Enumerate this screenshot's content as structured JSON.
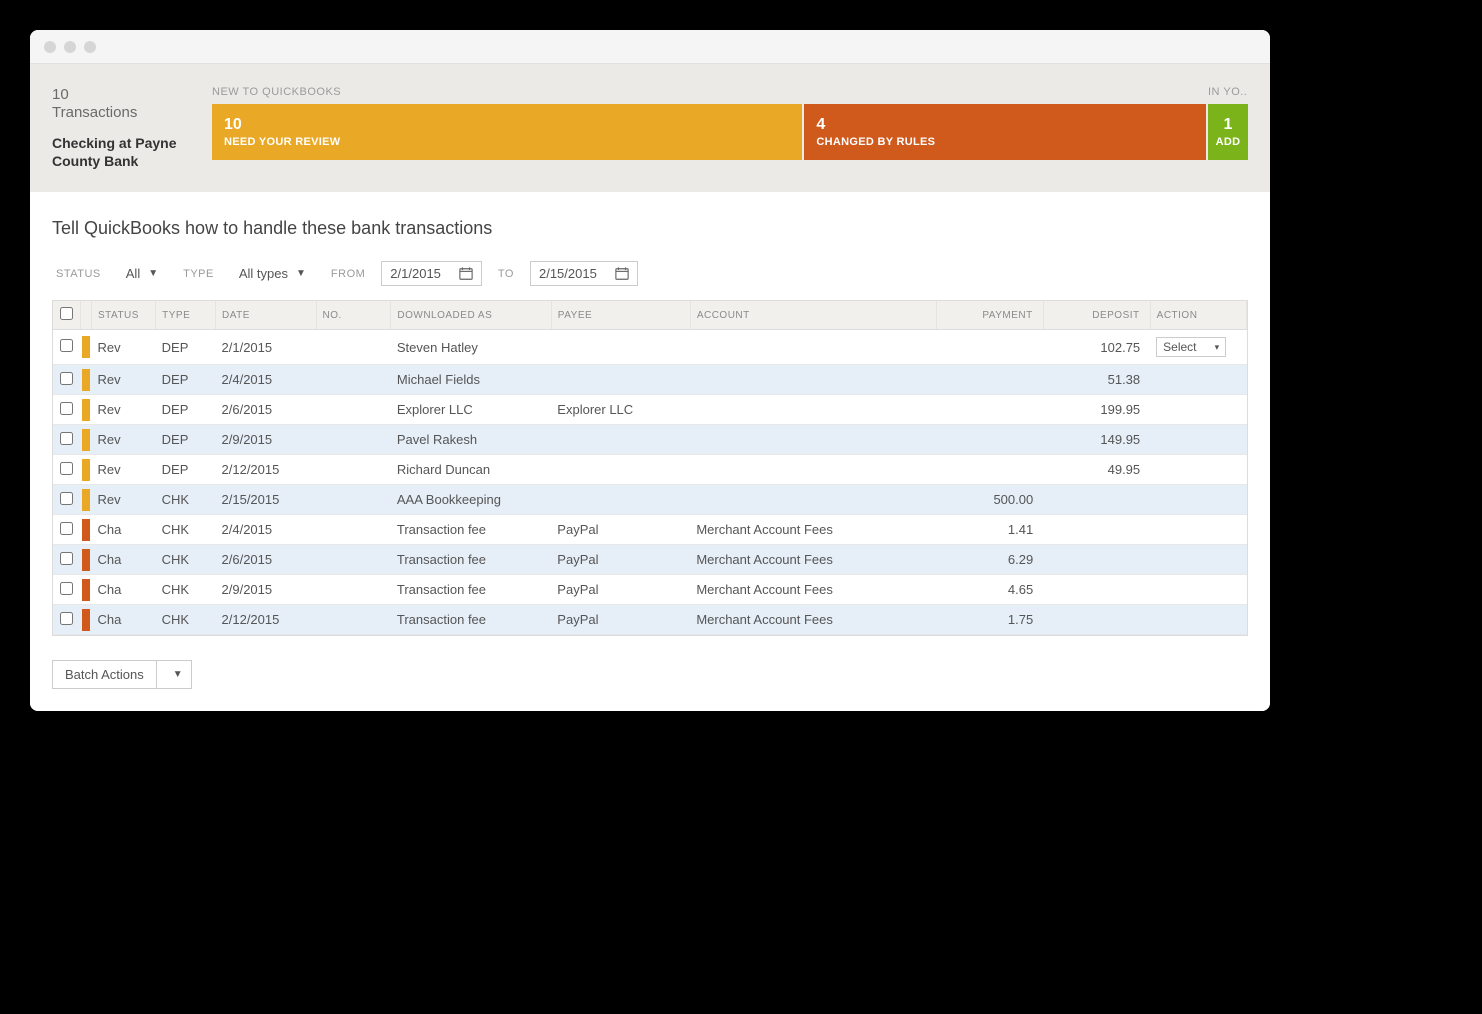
{
  "summary": {
    "count": "10",
    "count_label": "Transactions",
    "account": "Checking at Payne County Bank"
  },
  "tab_groups": {
    "left_label": "NEW TO QUICKBOOKS",
    "right_label": "IN YO..."
  },
  "tabs": {
    "review": {
      "count": "10",
      "label": "NEED YOUR REVIEW"
    },
    "changed": {
      "count": "4",
      "label": "CHANGED BY RULES"
    },
    "add": {
      "count": "1",
      "label": "ADD"
    }
  },
  "heading": "Tell QuickBooks how to handle these bank transactions",
  "filters": {
    "status_label": "STATUS",
    "status_value": "All",
    "type_label": "TYPE",
    "type_value": "All types",
    "from_label": "FROM",
    "from_value": "2/1/2015",
    "to_label": "TO",
    "to_value": "2/15/2015"
  },
  "columns": {
    "status": "STATUS",
    "type": "TYPE",
    "date": "DATE",
    "no": "NO.",
    "downloaded_as": "DOWNLOADED AS",
    "payee": "PAYEE",
    "account": "ACCOUNT",
    "payment": "PAYMENT",
    "deposit": "DEPOSIT",
    "action": "ACTION"
  },
  "rows": [
    {
      "stripe": "rev",
      "status": "Rev",
      "type": "DEP",
      "date": "2/1/2015",
      "no": "",
      "downloaded_as": "Steven Hatley",
      "payee": "",
      "account": "",
      "payment": "",
      "deposit": "102.75",
      "action": "Select"
    },
    {
      "stripe": "rev",
      "status": "Rev",
      "type": "DEP",
      "date": "2/4/2015",
      "no": "",
      "downloaded_as": "Michael Fields",
      "payee": "",
      "account": "",
      "payment": "",
      "deposit": "51.38",
      "action": ""
    },
    {
      "stripe": "rev",
      "status": "Rev",
      "type": "DEP",
      "date": "2/6/2015",
      "no": "",
      "downloaded_as": "Explorer LLC",
      "payee": "Explorer LLC",
      "account": "",
      "payment": "",
      "deposit": "199.95",
      "action": ""
    },
    {
      "stripe": "rev",
      "status": "Rev",
      "type": "DEP",
      "date": "2/9/2015",
      "no": "",
      "downloaded_as": "Pavel Rakesh",
      "payee": "",
      "account": "",
      "payment": "",
      "deposit": "149.95",
      "action": ""
    },
    {
      "stripe": "rev",
      "status": "Rev",
      "type": "DEP",
      "date": "2/12/2015",
      "no": "",
      "downloaded_as": "Richard Duncan",
      "payee": "",
      "account": "",
      "payment": "",
      "deposit": "49.95",
      "action": ""
    },
    {
      "stripe": "rev",
      "status": "Rev",
      "type": "CHK",
      "date": "2/15/2015",
      "no": "",
      "downloaded_as": "AAA Bookkeeping",
      "payee": "",
      "account": "",
      "payment": "500.00",
      "deposit": "",
      "action": ""
    },
    {
      "stripe": "cha",
      "status": "Cha",
      "type": "CHK",
      "date": "2/4/2015",
      "no": "",
      "downloaded_as": "Transaction fee",
      "payee": "PayPal",
      "account": "Merchant Account Fees",
      "payment": "1.41",
      "deposit": "",
      "action": ""
    },
    {
      "stripe": "cha",
      "status": "Cha",
      "type": "CHK",
      "date": "2/6/2015",
      "no": "",
      "downloaded_as": "Transaction fee",
      "payee": "PayPal",
      "account": "Merchant Account Fees",
      "payment": "6.29",
      "deposit": "",
      "action": ""
    },
    {
      "stripe": "cha",
      "status": "Cha",
      "type": "CHK",
      "date": "2/9/2015",
      "no": "",
      "downloaded_as": "Transaction fee",
      "payee": "PayPal",
      "account": "Merchant Account Fees",
      "payment": "4.65",
      "deposit": "",
      "action": ""
    },
    {
      "stripe": "cha",
      "status": "Cha",
      "type": "CHK",
      "date": "2/12/2015",
      "no": "",
      "downloaded_as": "Transaction fee",
      "payee": "PayPal",
      "account": "Merchant Account Fees",
      "payment": "1.75",
      "deposit": "",
      "action": ""
    }
  ],
  "batch_actions_label": "Batch Actions"
}
